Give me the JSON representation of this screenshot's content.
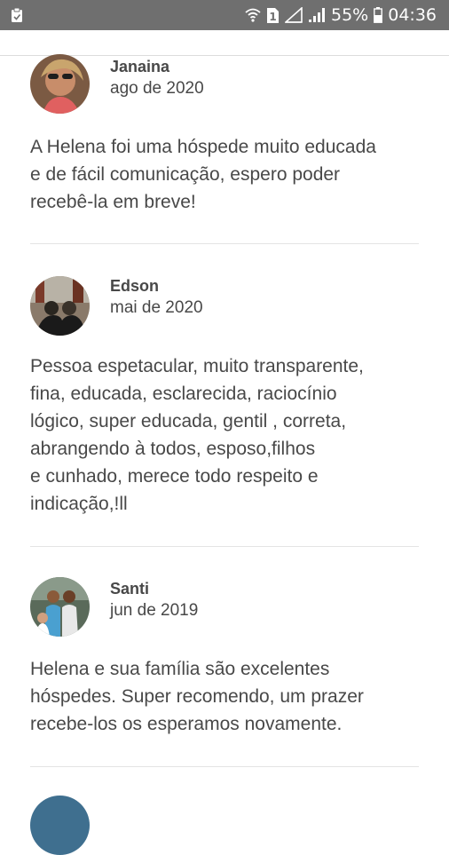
{
  "status_bar": {
    "battery_percent": "55%",
    "time": "04:36",
    "sim_badge": "1",
    "icons": [
      "clipboard-icon",
      "wifi-icon",
      "sim-icon",
      "no-signal-icon",
      "signal-icon",
      "battery-icon"
    ]
  },
  "reviews": [
    {
      "name": "Janaina",
      "date": "ago de 2020",
      "text": "A Helena foi uma hóspede muito educada\ne de fácil comunicação, espero poder\nrecebê-la em breve!"
    },
    {
      "name": "Edson",
      "date": "mai de 2020",
      "text": "Pessoa espetacular, muito transparente,\nfina, educada, esclarecida, raciocínio\nlógico, super educada, gentil , correta,\nabrangendo à todos, esposo,filhos\ne cunhado, merece todo respeito e\nindicação,!ll"
    },
    {
      "name": "Santi",
      "date": "jun de 2019",
      "text": "Helena e sua família são excelentes\nhóspedes. Super recomendo, um prazer\nrecebe-los os esperamos novamente."
    }
  ]
}
